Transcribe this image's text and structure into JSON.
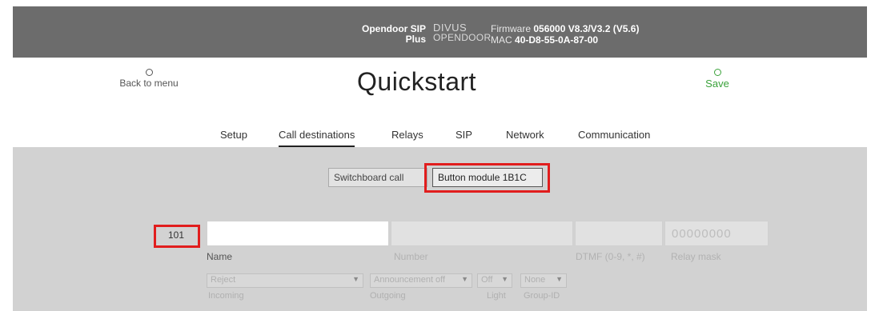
{
  "topbar": {
    "product_line1": "Opendoor SIP",
    "product_line2": "Plus",
    "logo_line1": "DIVUS",
    "logo_line2": "OPENDOOR",
    "firmware_label": "Firmware",
    "firmware_value": "056000 V8.3/V3.2 (V5.6)",
    "mac_label": "MAC",
    "mac_value": "40-D8-55-0A-87-00"
  },
  "header": {
    "back_label": "Back to menu",
    "title": "Quickstart",
    "save_label": "Save"
  },
  "tabs": [
    "Setup",
    "Call destinations",
    "Relays",
    "SIP",
    "Network",
    "Communication"
  ],
  "active_tab": "Call destinations",
  "subtabs": {
    "switchboard": "Switchboard call",
    "button_module": "Button module 1B1C"
  },
  "row": {
    "number_label": "101",
    "name_value": "",
    "name_label": "Name",
    "number_field_label": "Number",
    "dtmf_label": "DTMF (0-9, *, #)",
    "relay_value": "00000000",
    "relay_label": "Relay mask",
    "incoming_value": "Reject",
    "incoming_label": "Incoming",
    "outgoing_value": "Announcement off",
    "outgoing_label": "Outgoing",
    "light_value": "Off",
    "light_label": "Light",
    "group_value": "None",
    "group_label": "Group-ID"
  },
  "colors": {
    "topbar": "#6c6c6c",
    "save": "#3aa23a",
    "highlight": "#e11d1d",
    "content_bg": "#d2d2d2"
  },
  "icons": {
    "back": "circle-icon",
    "save": "circle-icon",
    "dropdown": "chevron-down-icon"
  }
}
